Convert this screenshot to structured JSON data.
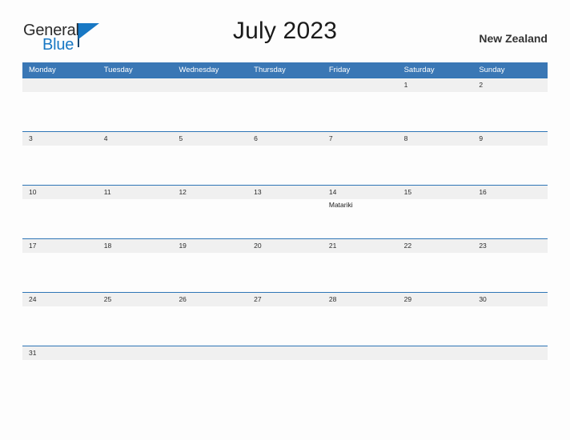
{
  "brand": {
    "name_part1": "General",
    "name_part2": "Blue",
    "flag_icon": "blue-triangle-flag"
  },
  "header": {
    "title": "July 2023",
    "region": "New Zealand"
  },
  "colors": {
    "header_blue": "#3a77b5",
    "separator_blue": "#2e75b6",
    "daynum_band": "#f0f0f0",
    "logo_blue": "#1878c4",
    "page_background": "#fdfdfd"
  },
  "calendar": {
    "day_headers": [
      "Monday",
      "Tuesday",
      "Wednesday",
      "Thursday",
      "Friday",
      "Saturday",
      "Sunday"
    ],
    "weeks": [
      [
        {
          "day": "",
          "event": ""
        },
        {
          "day": "",
          "event": ""
        },
        {
          "day": "",
          "event": ""
        },
        {
          "day": "",
          "event": ""
        },
        {
          "day": "",
          "event": ""
        },
        {
          "day": "1",
          "event": ""
        },
        {
          "day": "2",
          "event": ""
        }
      ],
      [
        {
          "day": "3",
          "event": ""
        },
        {
          "day": "4",
          "event": ""
        },
        {
          "day": "5",
          "event": ""
        },
        {
          "day": "6",
          "event": ""
        },
        {
          "day": "7",
          "event": ""
        },
        {
          "day": "8",
          "event": ""
        },
        {
          "day": "9",
          "event": ""
        }
      ],
      [
        {
          "day": "10",
          "event": ""
        },
        {
          "day": "11",
          "event": ""
        },
        {
          "day": "12",
          "event": ""
        },
        {
          "day": "13",
          "event": ""
        },
        {
          "day": "14",
          "event": "Matariki"
        },
        {
          "day": "15",
          "event": ""
        },
        {
          "day": "16",
          "event": ""
        }
      ],
      [
        {
          "day": "17",
          "event": ""
        },
        {
          "day": "18",
          "event": ""
        },
        {
          "day": "19",
          "event": ""
        },
        {
          "day": "20",
          "event": ""
        },
        {
          "day": "21",
          "event": ""
        },
        {
          "day": "22",
          "event": ""
        },
        {
          "day": "23",
          "event": ""
        }
      ],
      [
        {
          "day": "24",
          "event": ""
        },
        {
          "day": "25",
          "event": ""
        },
        {
          "day": "26",
          "event": ""
        },
        {
          "day": "27",
          "event": ""
        },
        {
          "day": "28",
          "event": ""
        },
        {
          "day": "29",
          "event": ""
        },
        {
          "day": "30",
          "event": ""
        }
      ],
      [
        {
          "day": "31",
          "event": ""
        },
        {
          "day": "",
          "event": ""
        },
        {
          "day": "",
          "event": ""
        },
        {
          "day": "",
          "event": ""
        },
        {
          "day": "",
          "event": ""
        },
        {
          "day": "",
          "event": ""
        },
        {
          "day": "",
          "event": ""
        }
      ]
    ]
  }
}
